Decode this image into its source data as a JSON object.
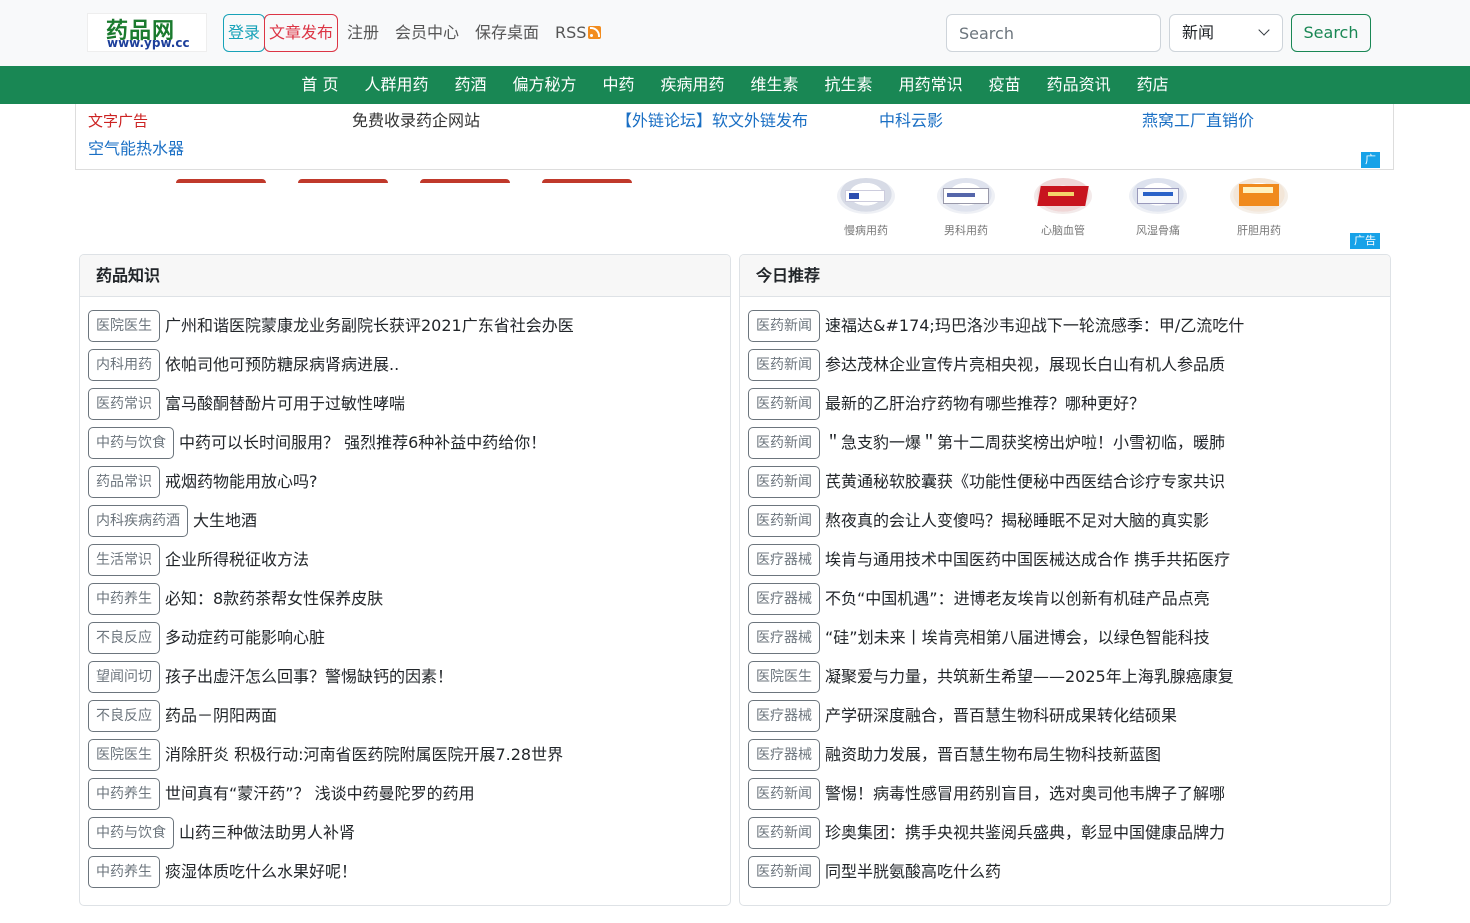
{
  "header": {
    "logo_cn": "药品网",
    "logo_en": "www.ypw.cc",
    "login": "登录",
    "publish": "文章发布",
    "links": [
      "注册",
      "会员中心",
      "保存桌面",
      "RSS"
    ],
    "search_placeholder": "Search",
    "search_category": "新闻",
    "search_button": "Search"
  },
  "nav": [
    "首 页",
    "人群用药",
    "药酒",
    "偏方秘方",
    "中药",
    "疾病用药",
    "维生素",
    "抗生素",
    "用药常识",
    "疫苗",
    "药品资讯",
    "药店"
  ],
  "text_ads": {
    "items": [
      "文字广告",
      "免费收录药企网站",
      "【外链论坛】软文外链发布",
      "中科云影",
      "燕窝工厂直销价",
      "空气能热水器"
    ],
    "badge": "广"
  },
  "image_ads": {
    "items": [
      "慢病用药",
      "男科用药",
      "心脑血管",
      "风湿骨痛",
      "肝胆用药"
    ],
    "badge": "广告"
  },
  "knowledge": {
    "title": "药品知识",
    "rows": [
      {
        "tag": "医院医生",
        "title": "广州和谐医院蒙康龙业务副院长获评2021广东省社会办医"
      },
      {
        "tag": "内科用药",
        "title": "依帕司他可预防糖尿病肾病进展.."
      },
      {
        "tag": "医药常识",
        "title": "富马酸酮替酚片可用于过敏性哮喘"
      },
      {
        "tag": "中药与饮食",
        "title": "中药可以长时间服用？ 强烈推荐6种补益中药给你！"
      },
      {
        "tag": "药品常识",
        "title": "戒烟药物能用放心吗?"
      },
      {
        "tag": "内科疾病药酒",
        "title": "大生地酒"
      },
      {
        "tag": "生活常识",
        "title": "企业所得税征收方法"
      },
      {
        "tag": "中药养生",
        "title": "必知：8款药茶帮女性保养皮肤"
      },
      {
        "tag": "不良反应",
        "title": "多动症药可能影响心脏"
      },
      {
        "tag": "望闻问切",
        "title": "孩子出虚汗怎么回事？警惕缺钙的因素！"
      },
      {
        "tag": "不良反应",
        "title": "药品－阴阳两面"
      },
      {
        "tag": "医院医生",
        "title": "消除肝炎 积极行动:河南省医药院附属医院开展7.28世界"
      },
      {
        "tag": "中药养生",
        "title": "世间真有“蒙汗药”？ 浅谈中药曼陀罗的药用"
      },
      {
        "tag": "中药与饮食",
        "title": "山药三种做法助男人补肾"
      },
      {
        "tag": "中药养生",
        "title": "痰湿体质吃什么水果好呢！"
      }
    ]
  },
  "today": {
    "title": "今日推荐",
    "rows": [
      {
        "tag": "医药新闻",
        "title": "速福达&#174;玛巴洛沙韦迎战下一轮流感季：甲/乙流吃什"
      },
      {
        "tag": "医药新闻",
        "title": "参达茂林企业宣传片亮相央视，展现长白山有机人参品质"
      },
      {
        "tag": "医药新闻",
        "title": "最新的乙肝治疗药物有哪些推荐？哪种更好？"
      },
      {
        "tag": "医药新闻",
        "title": "＂急支豹一爆＂第十二周获奖榜出炉啦！小雪初临，暖肺"
      },
      {
        "tag": "医药新闻",
        "title": "芪黄通秘软胶囊获《功能性便秘中西医结合诊疗专家共识"
      },
      {
        "tag": "医药新闻",
        "title": "熬夜真的会让人变傻吗？揭秘睡眠不足对大脑的真实影"
      },
      {
        "tag": "医疗器械",
        "title": "埃肯与通用技术中国医药中国医械达成合作 携手共拓医疗"
      },
      {
        "tag": "医疗器械",
        "title": "不负“中国机遇”：进博老友埃肯以创新有机硅产品点亮"
      },
      {
        "tag": "医疗器械",
        "title": "“硅”划未来丨埃肯亮相第八届进博会，以绿色智能科技"
      },
      {
        "tag": "医院医生",
        "title": "凝聚爱与力量，共筑新生希望——2025年上海乳腺癌康复"
      },
      {
        "tag": "医疗器械",
        "title": "产学研深度融合，晋百慧生物科研成果转化结硕果"
      },
      {
        "tag": "医疗器械",
        "title": "融资助力发展，晋百慧生物布局生物科技新蓝图"
      },
      {
        "tag": "医药新闻",
        "title": "警惕！病毒性感冒用药别盲目，选对奥司他韦牌子了解哪"
      },
      {
        "tag": "医药新闻",
        "title": "珍奥集团：携手央视共鉴阅兵盛典，彰显中国健康品牌力"
      },
      {
        "tag": "医药新闻",
        "title": "同型半胱氨酸高吃什么药"
      }
    ]
  },
  "colors": {
    "brand_green": "#198754",
    "login_cyan": "#17a2b8",
    "publish_red": "#dc3545",
    "ad_red": "#cc2222",
    "ad_blue": "#1a6fc4",
    "badge_blue": "#17a2e8"
  }
}
